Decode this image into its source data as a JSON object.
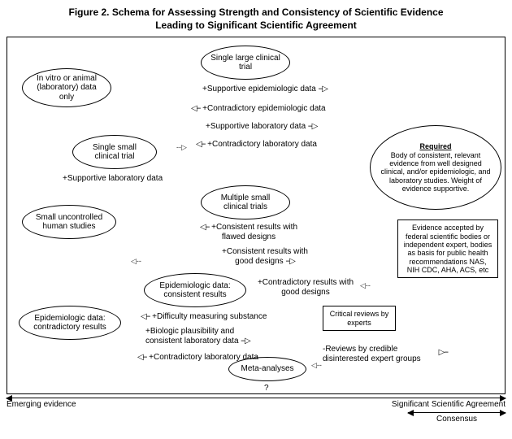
{
  "title_line1": "Figure 2.  Schema for Assessing Strength and Consistency of Scientific Evidence",
  "title_line2": "Leading to Significant Scientific Agreement",
  "nodes": {
    "invitro": "In vitro or animal (laboratory) data only",
    "single_large": "Single large clinical trial",
    "single_small": "Single small clinical trial",
    "small_uncontrolled": "Small uncontrolled human studies",
    "multiple_small": "Multiple small clinical trials",
    "epi_consistent": "Epidemiologic data: consistent results",
    "epi_contradictory": "Epidemiologic data: contradictory results",
    "meta": "Meta-analyses",
    "required_title": "Required",
    "required_body": "Body of consistent, relevant evidence from well designed clinical, and/or epidemiologic, and laboratory studies. Weight of evidence supportive.",
    "accepted": "Evidence accepted by federal scientific bodies or independent expert, bodies as basis for public health recommendations NAS, NIH  CDC, AHA, ACS, etc",
    "critical": "Critical reviews by experts"
  },
  "labels": {
    "supportive_epi": "+Supportive epidemiologic data",
    "contradictory_epi": "+Contradictory epidemiologic data",
    "supportive_lab": "+Supportive laboratory data",
    "contradictory_lab": "+Contradictory laboratory data",
    "supportive_lab2": "+Supportive laboratory data",
    "consistent_flawed": "+Consistent results with flawed designs",
    "consistent_good": "+Consistent results with good designs",
    "contradictory_good": "+Contradictory results with good designs",
    "difficulty": "+Difficulty measuring substance",
    "bioplaus": "+Biologic plausibility and consistent laboratory data",
    "contradictory_lab2": "+Contradictory laboratory data",
    "reviews_disinterested": "-Reviews by credible disinterested expert groups",
    "qmark": "?"
  },
  "axis": {
    "left": "Emerging evidence",
    "right": "Significant Scientific Agreement",
    "consensus": "Consensus"
  }
}
